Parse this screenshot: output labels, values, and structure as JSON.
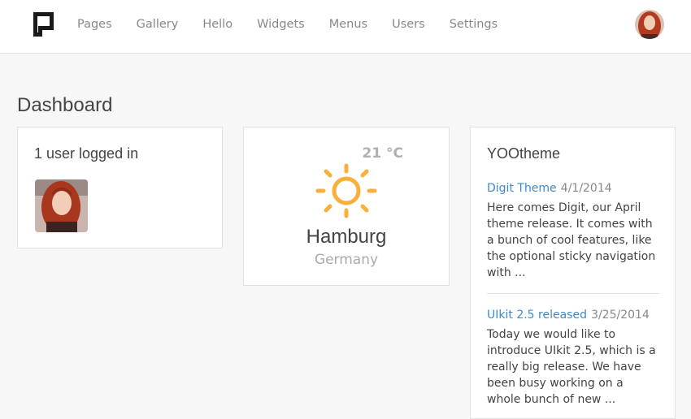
{
  "nav": {
    "items": [
      {
        "label": "Pages"
      },
      {
        "label": "Gallery"
      },
      {
        "label": "Hello"
      },
      {
        "label": "Widgets"
      },
      {
        "label": "Menus"
      },
      {
        "label": "Users"
      },
      {
        "label": "Settings"
      }
    ]
  },
  "page": {
    "title": "Dashboard"
  },
  "users_widget": {
    "heading": "1 user logged in"
  },
  "weather_widget": {
    "temperature": "21 °C",
    "city": "Hamburg",
    "country": "Germany",
    "icon": "sun-icon",
    "icon_color": "#f9b03b"
  },
  "feed_widget": {
    "heading": "YOOtheme",
    "items": [
      {
        "title": "Digit Theme",
        "date": "4/1/2014",
        "text": "Here comes Digit, our April theme release. It comes with a bunch of cool features, like the optional sticky navigation with ..."
      },
      {
        "title": "UIkit 2.5 released",
        "date": "3/25/2014",
        "text": "Today we would like to introduce UIkit 2.5, which is a really big release. We have been busy working on a whole bunch of new ..."
      }
    ]
  },
  "colors": {
    "link": "#3a8ad6",
    "background": "#f7f7f7",
    "panel": "#ffffff",
    "border": "#e2e2e2"
  }
}
